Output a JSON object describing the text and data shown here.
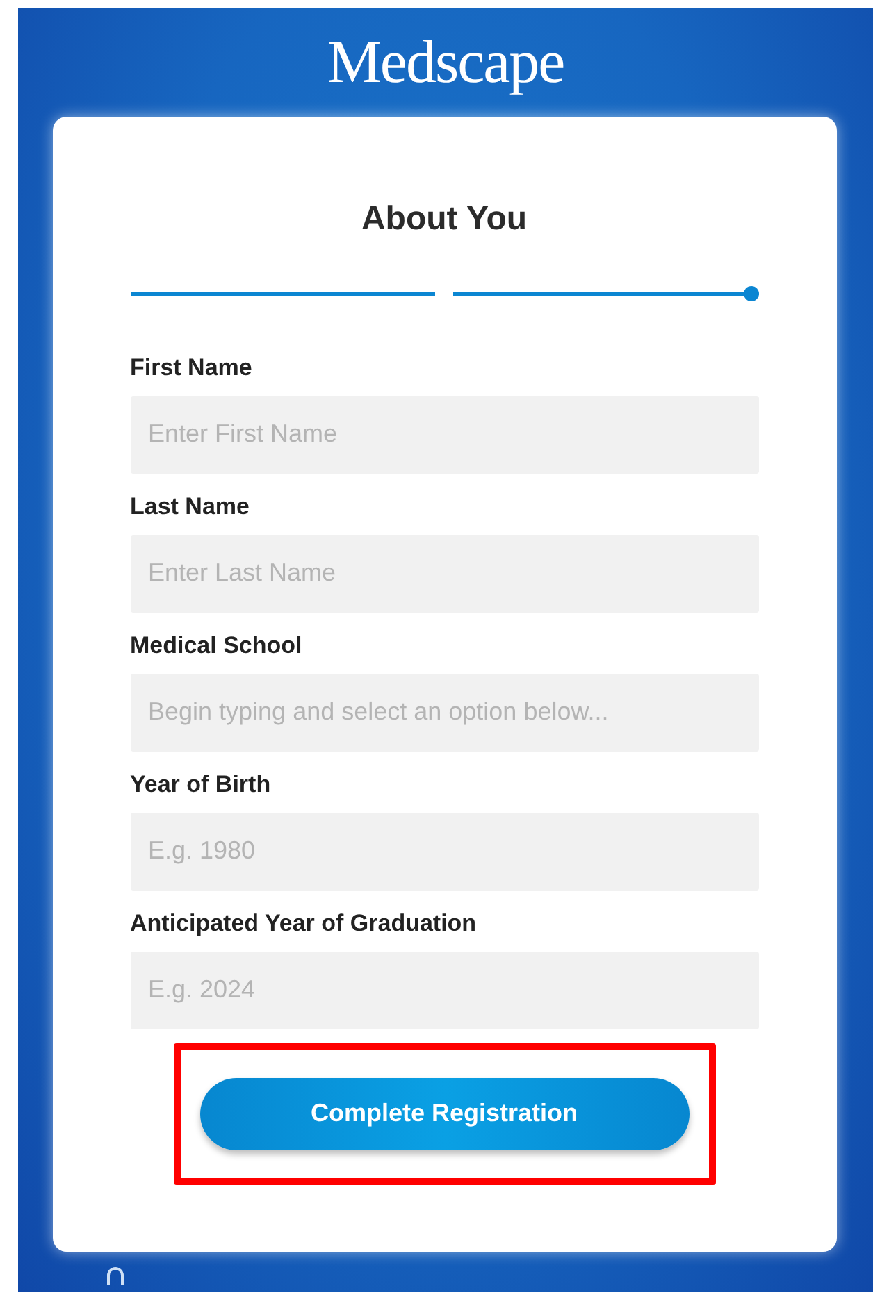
{
  "logo": "Medscape",
  "form": {
    "title": "About You",
    "progress": [
      {
        "complete": true,
        "current": false
      },
      {
        "complete": true,
        "current": true
      }
    ],
    "fields": [
      {
        "label": "First Name",
        "placeholder": "Enter First Name"
      },
      {
        "label": "Last Name",
        "placeholder": "Enter Last Name"
      },
      {
        "label": "Medical School",
        "placeholder": "Begin typing and select an option below..."
      },
      {
        "label": "Year of Birth",
        "placeholder": "E.g. 1980"
      },
      {
        "label": "Anticipated Year of Graduation",
        "placeholder": "E.g. 2024"
      }
    ],
    "submit": {
      "label": "Complete Registration",
      "highlighted": true
    }
  }
}
